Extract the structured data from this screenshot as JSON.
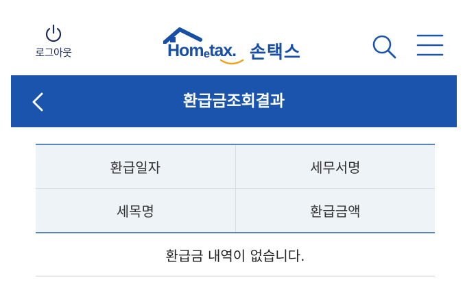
{
  "header": {
    "logout_label": "로그아웃",
    "logo_text_home": "Hom",
    "logo_text_e": "e",
    "logo_text_tax": "tax.",
    "logo_korean": "손택스"
  },
  "titlebar": {
    "title": "환급금조회결과"
  },
  "table": {
    "headers_row1": [
      "환급일자",
      "세무서명"
    ],
    "headers_row2": [
      "세목명",
      "환급금액"
    ],
    "empty_message": "환급금 내역이 없습니다."
  },
  "colors": {
    "brand_blue": "#1a54ad",
    "logo_blue": "#164fa5",
    "header_cell_bg": "#eef3f7",
    "swoosh_orange": "#f0a11c"
  },
  "icons": {
    "logout": "power-icon",
    "search": "search-icon",
    "menu": "menu-icon",
    "back": "chevron-left-icon",
    "logo_house": "house-roof-icon"
  }
}
